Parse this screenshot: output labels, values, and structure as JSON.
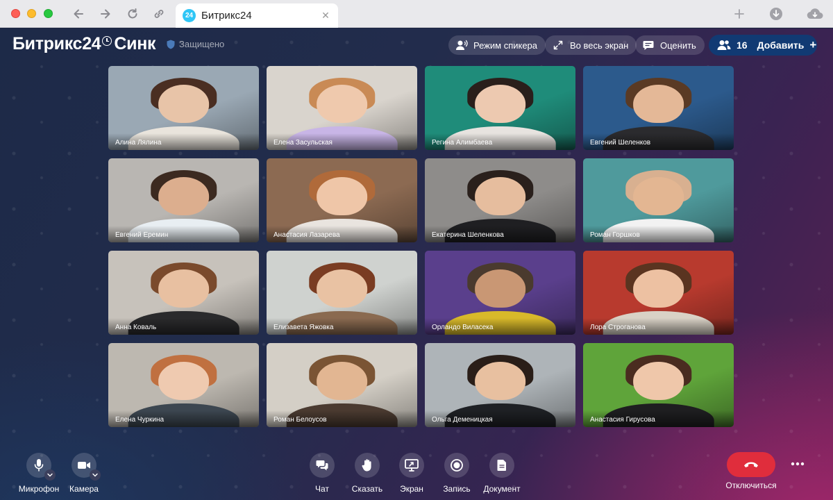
{
  "browser": {
    "tab_title": "Битрикс24",
    "tab_favicon_text": "24"
  },
  "topbar": {
    "brand_name": "Битрикс24",
    "brand_product": "Синк",
    "secure_label": "Защищено",
    "speaker_mode_label": "Режим спикера",
    "fullscreen_label": "Во весь экран",
    "rate_label": "Оценить",
    "participants_count": "16",
    "add_label": "Добавить",
    "add_plus": "+"
  },
  "participants": [
    {
      "name": "Алина Лялина",
      "bg": "#9aa8b4",
      "skin": "#e8c4a8",
      "hair": "#4a2e22",
      "shirt": "#e9e4dc"
    },
    {
      "name": "Елена Засульская",
      "bg": "#d9d4cd",
      "skin": "#efc9ad",
      "hair": "#c98a55",
      "shirt": "#c8b5e6"
    },
    {
      "name": "Регина Алимбаева",
      "bg": "#1f8c7a",
      "skin": "#edc9b0",
      "hair": "#2a1f1b",
      "shirt": "#e7e3df"
    },
    {
      "name": "Евгений Шеленков",
      "bg": "#2c5a8c",
      "skin": "#e4b897",
      "hair": "#5a3a24",
      "shirt": "#2b2b2e"
    },
    {
      "name": "Евгений Еремин",
      "bg": "#b9b6b2",
      "skin": "#dcae8e",
      "hair": "#3c2a20",
      "shirt": "#e8eef2"
    },
    {
      "name": "Анастасия Лазарева",
      "bg": "#8c6a52",
      "skin": "#efc6a8",
      "hair": "#b06a3a",
      "shirt": "#e9e4df"
    },
    {
      "name": "Екатерина Шеленкова",
      "bg": "#8e8c8a",
      "skin": "#e6bd9e",
      "hair": "#2a201c",
      "shirt": "#1f1f22"
    },
    {
      "name": "Роман Горшков",
      "bg": "#4f9a9c",
      "skin": "#e3b692",
      "hair": "#d8b090",
      "shirt": "#f2f2f2"
    },
    {
      "name": "Анна Коваль",
      "bg": "#c7c2bb",
      "skin": "#e8c0a1",
      "hair": "#7a4a2c",
      "shirt": "#2a2a2c"
    },
    {
      "name": "Елизавета Яжовка",
      "bg": "#cfd2cf",
      "skin": "#e9c2a3",
      "hair": "#7a3c22",
      "shirt": "#8a6a50"
    },
    {
      "name": "Орландо Виласека",
      "bg": "#5a3f8c",
      "skin": "#c99774",
      "hair": "#4a3a2e",
      "shirt": "#d8b92a"
    },
    {
      "name": "Лора Строганова",
      "bg": "#b83a2e",
      "skin": "#edc1a2",
      "hair": "#5a3420",
      "shirt": "#d9d2c6"
    },
    {
      "name": "Елена Чуркина",
      "bg": "#bdb8b0",
      "skin": "#efcab0",
      "hair": "#c07040",
      "shirt": "#3c4650"
    },
    {
      "name": "Роман Белоусов",
      "bg": "#d4cfc6",
      "skin": "#e2b692",
      "hair": "#7a5434",
      "shirt": "#4a3a30"
    },
    {
      "name": "Ольга Деменицкая",
      "bg": "#aeb4b8",
      "skin": "#e8c0a0",
      "hair": "#2a1e18",
      "shirt": "#1e2024"
    },
    {
      "name": "Анастасия Гирусова",
      "bg": "#5fa43a",
      "skin": "#efc7aa",
      "hair": "#4a2c20",
      "shirt": "#1e1e20"
    }
  ],
  "controls": {
    "microphone_label": "Микрофон",
    "camera_label": "Камера",
    "chat_label": "Чат",
    "raise_hand_label": "Сказать",
    "screen_label": "Экран",
    "record_label": "Запись",
    "document_label": "Документ",
    "hangup_label": "Отключиться"
  }
}
